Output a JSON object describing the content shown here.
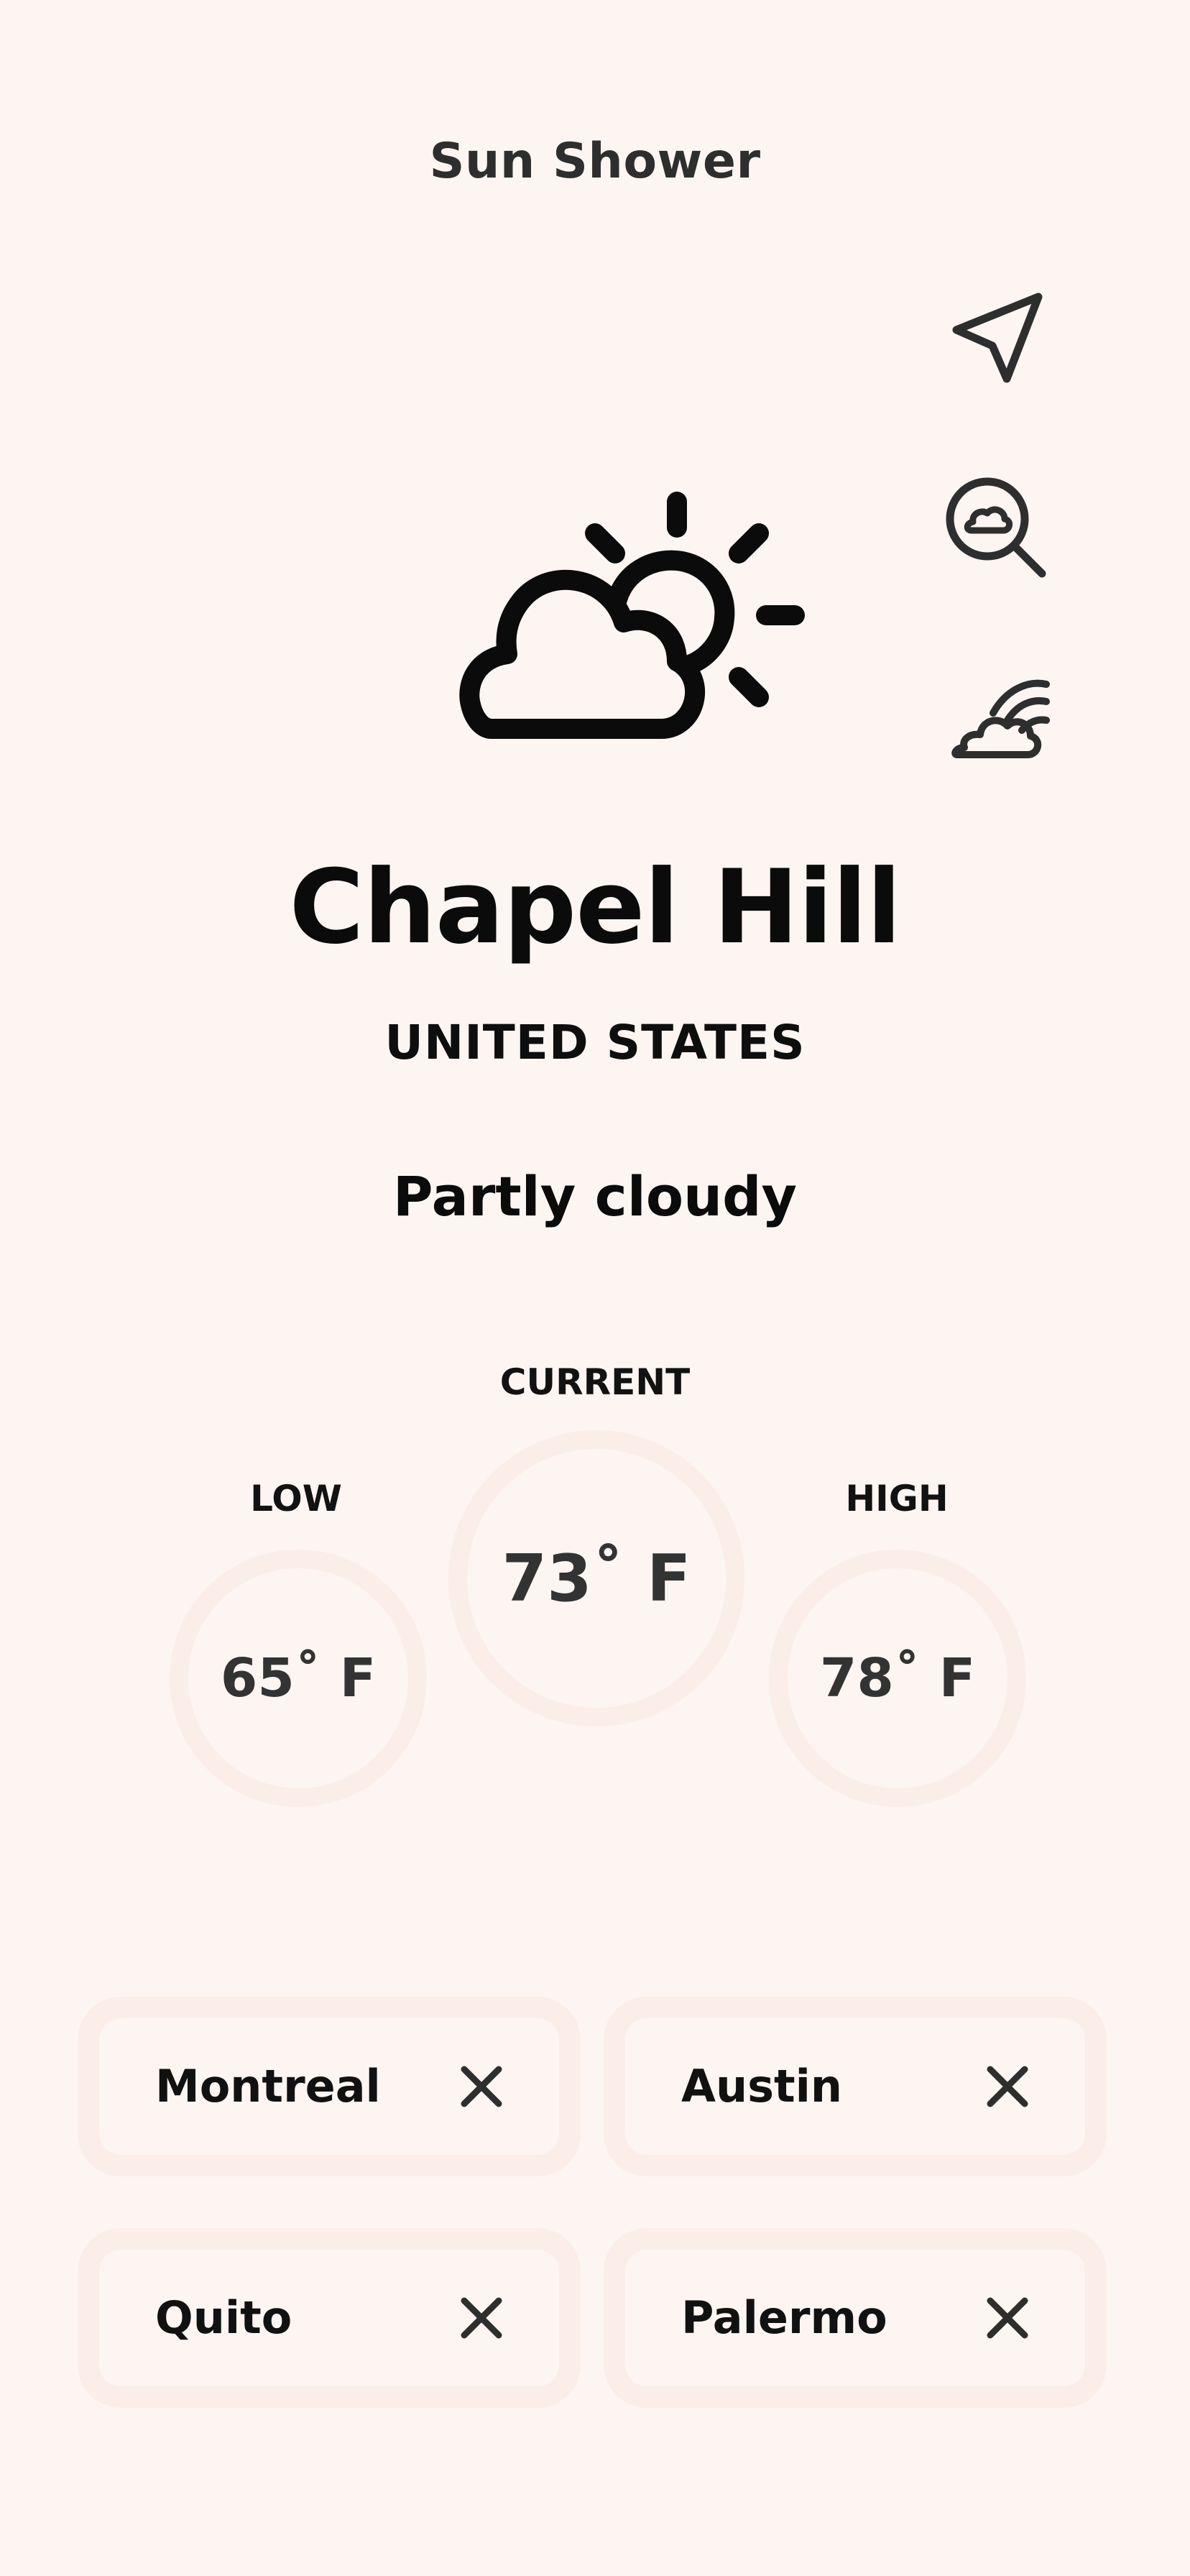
{
  "app": {
    "title": "Sun Shower"
  },
  "actions": [
    {
      "name": "current-location",
      "icon": "navigation-arrow-icon"
    },
    {
      "name": "search-weather",
      "icon": "cloud-search-icon"
    },
    {
      "name": "weather-map",
      "icon": "cloud-wind-icon"
    }
  ],
  "weather": {
    "icon": "partly-cloudy-icon",
    "city": "Chapel Hill",
    "country": "UNITED STATES",
    "condition": "Partly cloudy"
  },
  "temperatures": {
    "low": {
      "label": "LOW",
      "value": "65˚ F"
    },
    "current": {
      "label": "CURRENT",
      "value": "73˚ F"
    },
    "high": {
      "label": "HIGH",
      "value": "78˚ F"
    }
  },
  "saved_cities": [
    {
      "name": "Montreal",
      "remove_icon": "close-icon"
    },
    {
      "name": "Austin",
      "remove_icon": "close-icon"
    },
    {
      "name": "Quito",
      "remove_icon": "close-icon"
    },
    {
      "name": "Palermo",
      "remove_icon": "close-icon"
    }
  ],
  "colors": {
    "background": "#fdf5f2",
    "ring": "#fbede8",
    "text": "#111111",
    "icon": "#2e2e2e"
  }
}
